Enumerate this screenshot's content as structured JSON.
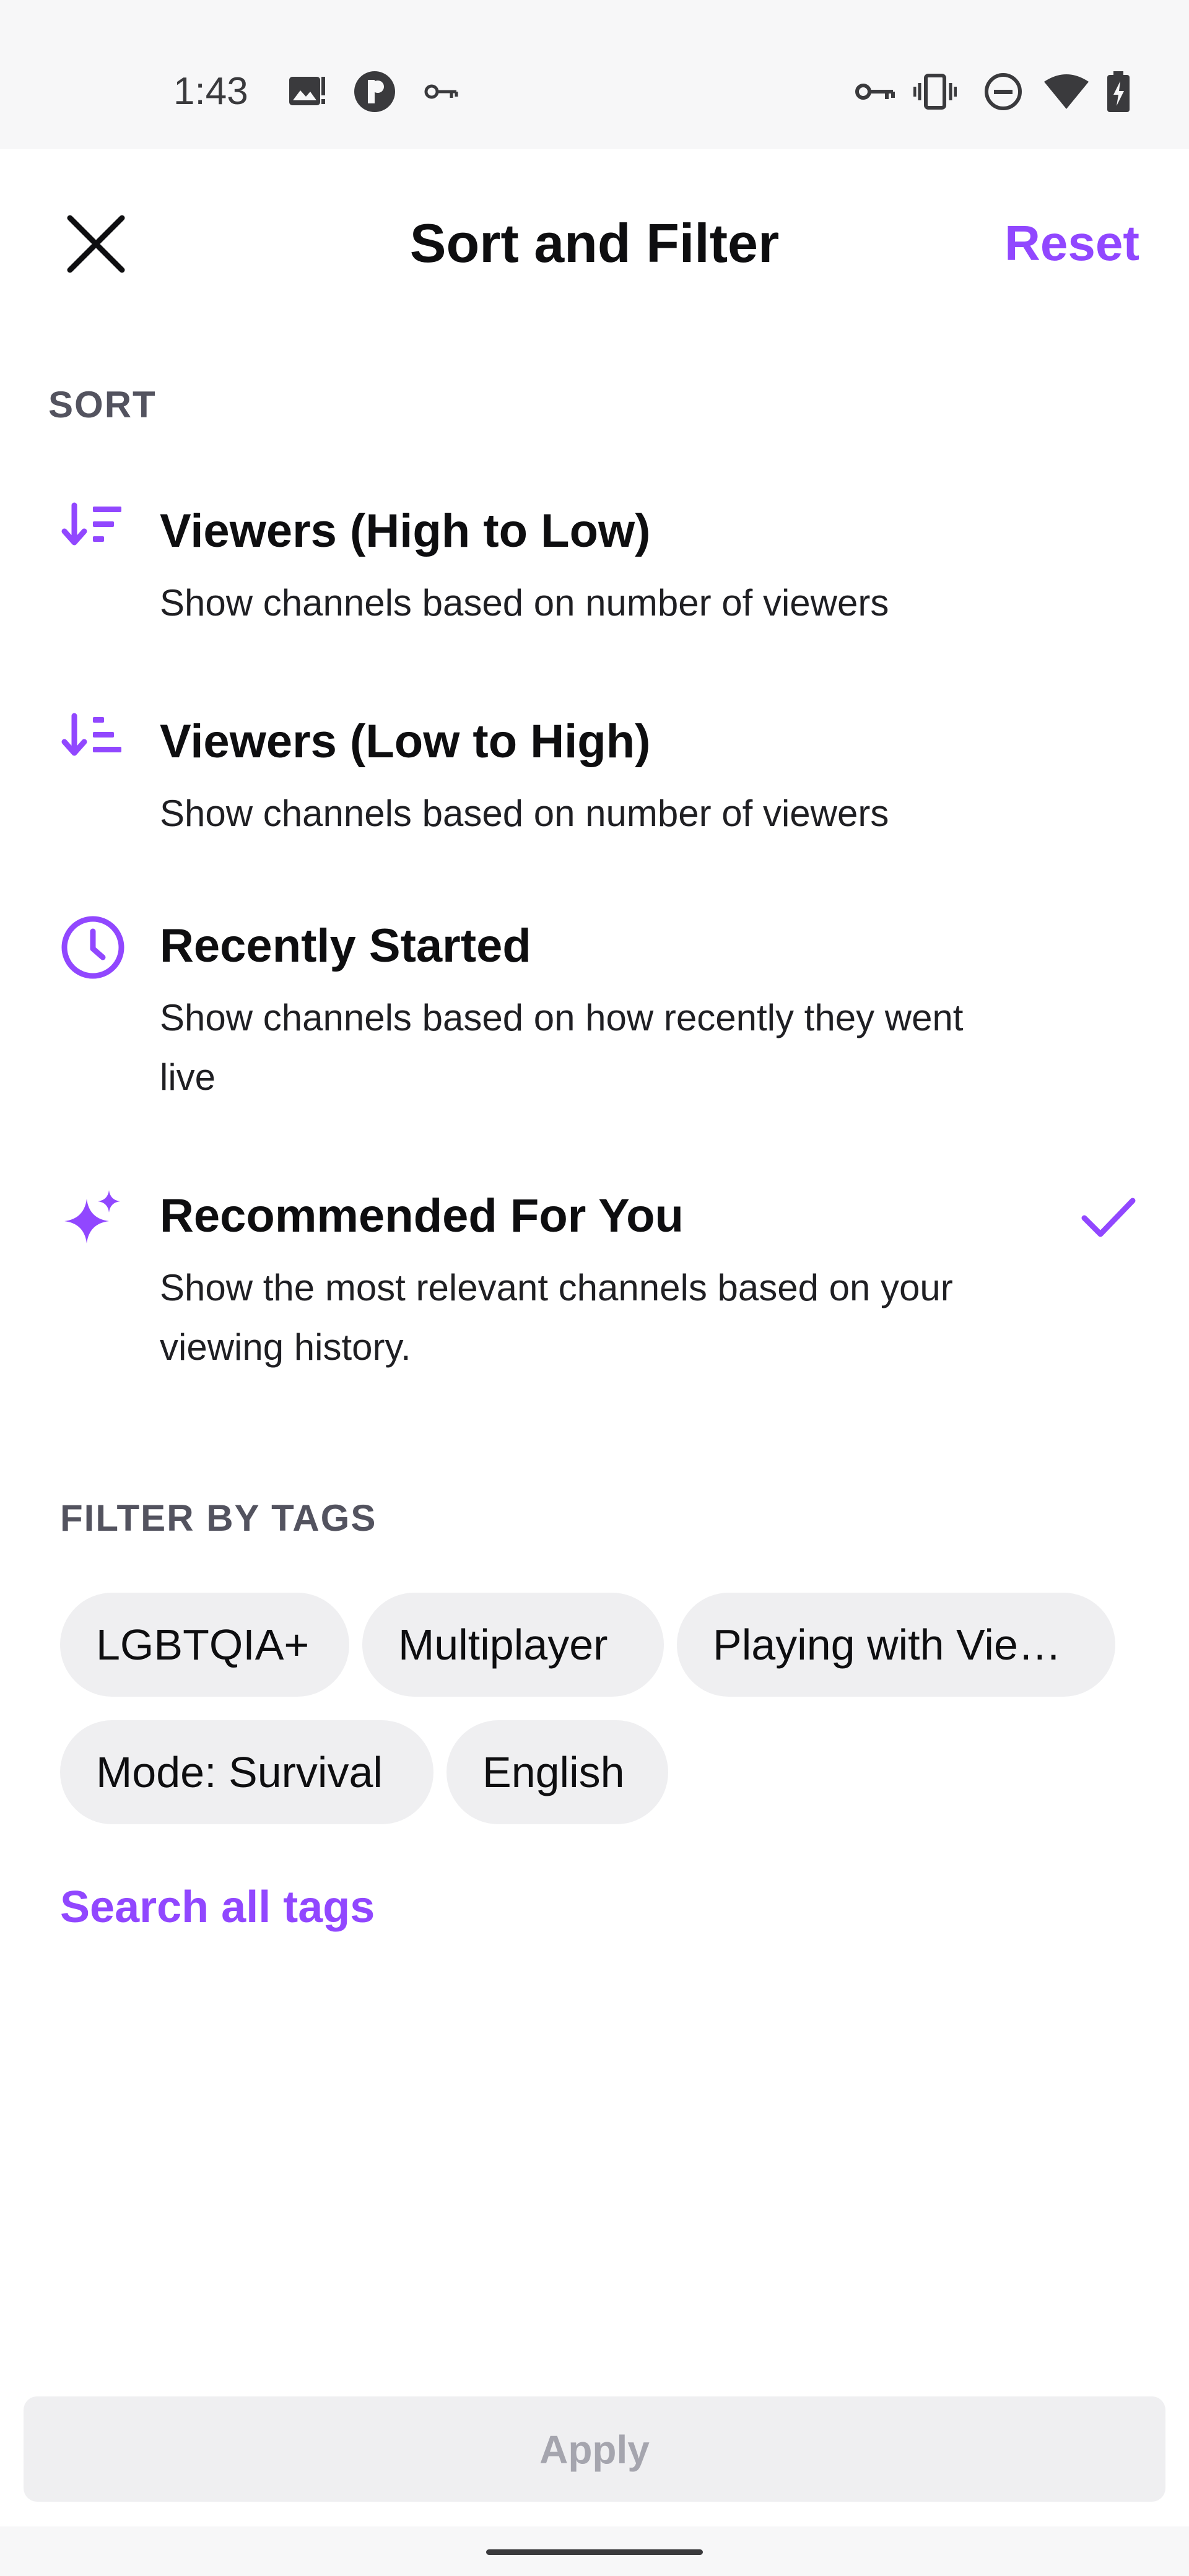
{
  "status_bar": {
    "time": "1:43",
    "left_icons": [
      "image-notification-icon",
      "circle-app-icon",
      "vpn-key-icon"
    ],
    "right_icons": [
      "vpn-key-icon",
      "vibrate-icon",
      "do-not-disturb-icon",
      "wifi-icon",
      "battery-charging-icon"
    ]
  },
  "header": {
    "title": "Sort and Filter",
    "reset_label": "Reset",
    "close_icon": "close-icon"
  },
  "sort": {
    "label": "SORT",
    "options": [
      {
        "title": "Viewers (High to Low)",
        "description": "Show channels based on number of viewers",
        "icon": "sort-descending-icon",
        "selected": false
      },
      {
        "title": "Viewers (Low to High)",
        "description": "Show channels based on number of viewers",
        "icon": "sort-ascending-icon",
        "selected": false
      },
      {
        "title": "Recently Started",
        "description": "Show channels based on how recently they went live",
        "icon": "clock-icon",
        "selected": false
      },
      {
        "title": "Recommended For You",
        "description": "Show the most relevant channels based on your viewing history.",
        "icon": "sparkle-icon",
        "selected": true
      }
    ]
  },
  "filter": {
    "label": "FILTER BY TAGS",
    "tags": [
      "LGBTQIA+",
      "Multiplayer",
      "Playing with Vie…",
      "Mode: Survival",
      "English"
    ],
    "search_all_label": "Search all tags"
  },
  "footer": {
    "apply_label": "Apply"
  },
  "colors": {
    "accent": "#9147ff",
    "text": "#0e0e10",
    "chip_bg": "#efeff1",
    "disabled_text": "#a5a5ae"
  }
}
